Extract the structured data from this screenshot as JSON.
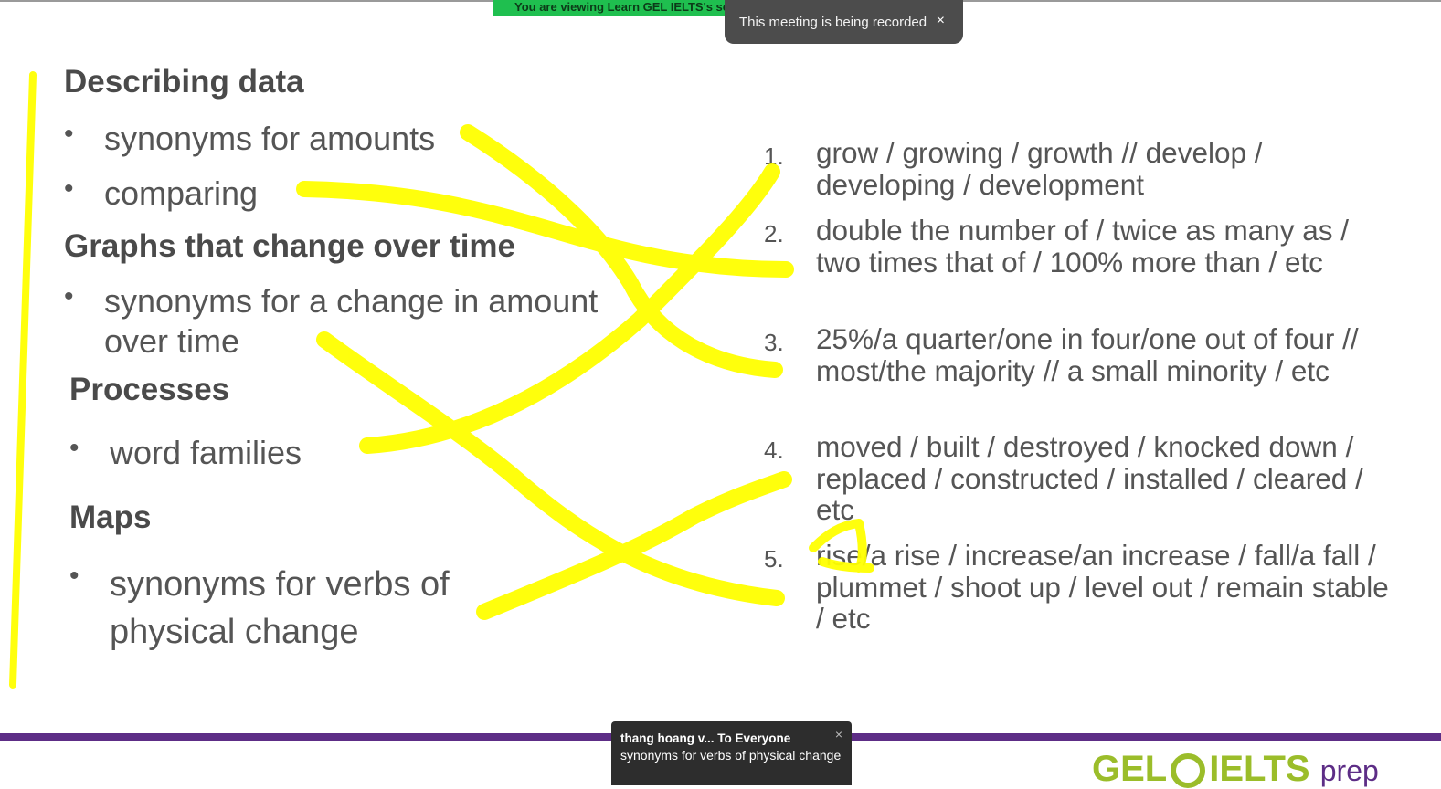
{
  "banner": {
    "text": "You are viewing  Learn GEL IELTS's sc"
  },
  "recording_toast": {
    "text": "This meeting is being recorded",
    "close": "×"
  },
  "left": {
    "heading1": "Describing data",
    "b1": "synonyms for amounts",
    "b2": "comparing",
    "heading2": "Graphs that change over time",
    "b3_line1": "synonyms for a change in amount",
    "b3_line2": "over time",
    "heading3": "Processes",
    "b4": "word families",
    "heading4": "Maps",
    "b5_line1": "synonyms for verbs of",
    "b5_line2": "physical change",
    "bullet": "•"
  },
  "right": [
    {
      "num": "1.",
      "text": "grow / growing / growth // develop / developing / development"
    },
    {
      "num": "2.",
      "text": "double the number of / twice as many as / two times that of  / 100% more than / etc"
    },
    {
      "num": "3.",
      "text": "25%/a quarter/one in four/one out of four // most/the majority // a small minority / etc"
    },
    {
      "num": "4.",
      "text": "moved / built / destroyed / knocked down / replaced / constructed / installed / cleared / etc"
    },
    {
      "num": "5.",
      "text": "rise/a rise / increase/an increase / fall/a fall / plummet / shoot up / level out / remain stable / etc"
    }
  ],
  "chat": {
    "from": "thang hoang v... To Everyone",
    "message": "synonyms for verbs of physical change",
    "close": "×"
  },
  "logo": {
    "gel": "GEL",
    "ielts": "IELTS",
    "prep": "prep"
  },
  "colors": {
    "highlighter": "#ffff00",
    "brand_purple": "#5d2d86",
    "brand_green": "#9bbd2a",
    "share_green": "#1fbf4f"
  }
}
